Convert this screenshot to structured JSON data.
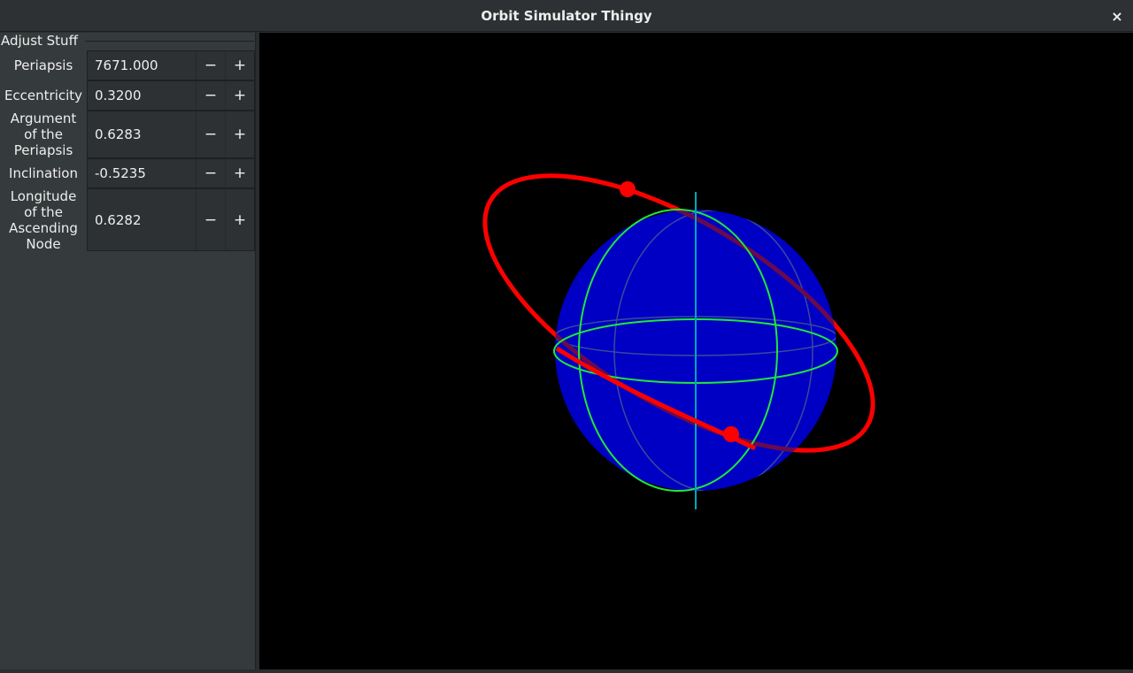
{
  "window": {
    "title": "Orbit Simulator Thingy",
    "close_glyph": "×"
  },
  "panel": {
    "group_label": "Adjust Stuff",
    "params": [
      {
        "label": "Periapsis",
        "value": "7671.000",
        "minus": "−",
        "plus": "+"
      },
      {
        "label": "Eccentricity",
        "value": "0.3200",
        "minus": "−",
        "plus": "+"
      },
      {
        "label": "Argument of the Periapsis",
        "value": "0.6283",
        "minus": "−",
        "plus": "+"
      },
      {
        "label": "Inclination",
        "value": "-0.5235",
        "minus": "−",
        "plus": "+"
      },
      {
        "label": "Longitude of the Ascending Node",
        "value": "0.6282",
        "minus": "−",
        "plus": "+"
      }
    ]
  },
  "scene": {
    "planet_color": "#0000cc",
    "grid_color": "#00ff3c",
    "axis_color": "#00a0b0",
    "orbit_color": "#ff0000",
    "background": "#000000"
  }
}
